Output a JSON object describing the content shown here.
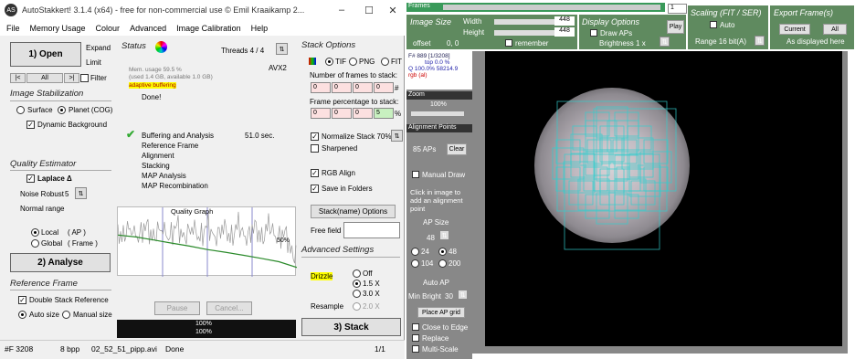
{
  "window": {
    "title": "AutoStakkert! 3.1.4 (x64) - free for non-commercial use © Emil Kraaikamp 2...",
    "min": "–",
    "max": "☐",
    "close": "✕"
  },
  "menu": [
    "File",
    "Memory Usage",
    "Colour",
    "Advanced",
    "Image Calibration",
    "Help"
  ],
  "left": {
    "open": "1) Open",
    "expand": "Expand",
    "limit": "Limit",
    "nav": {
      "first": "|<",
      "all": "All",
      ">|": ">|",
      "filter": "Filter"
    },
    "stab_title": "Image Stabilization",
    "surface": "Surface",
    "planet": "Planet (COG)",
    "dynbg": "Dynamic Background",
    "qe_title": "Quality Estimator",
    "laplace": "Laplace Δ",
    "noise": "Noise Robust",
    "noise_val": "5",
    "normal": "Normal range",
    "local": "Local",
    "local_sub": "( AP )",
    "global": "Global",
    "global_sub": "( Frame )",
    "analyse": "2) Analyse",
    "ref_title": "Reference Frame",
    "double": "Double Stack Reference",
    "autosize": "Auto size",
    "manualsize": "Manual size"
  },
  "status": {
    "title": "Status",
    "threads": "Threads 4 / 4",
    "avx": "AVX2",
    "mem1": "Mem. usage 59.5 %",
    "mem2": "(used 1.4 GB, available 1.0 GB)",
    "adaptive": "adaptive buffering",
    "done": "Done!",
    "steps": [
      "Buffering and Analysis",
      "Reference Frame",
      "Alignment",
      "Stacking",
      "MAP Analysis",
      "MAP Recombination"
    ],
    "time": "51.0 sec.",
    "graph_title": "Quality Graph",
    "graph_pct": "50%",
    "pause": "Pause",
    "cancel": "Cancel...",
    "prog1": "100%",
    "prog2": "100%"
  },
  "stack": {
    "title": "Stack Options",
    "tif": "TIF",
    "png": "PNG",
    "fit": "FIT",
    "nframes": "Number of frames to stack:",
    "nvals": [
      "0",
      "0",
      "0",
      "0"
    ],
    "hash": "#",
    "pct": "Frame percentage to stack:",
    "pvals": [
      "0",
      "0",
      "0",
      "5"
    ],
    "pctsign": "%",
    "normalize": "Normalize Stack 70%",
    "sharpened": "Sharpened",
    "rgb": "RGB Align",
    "folders": "Save in Folders",
    "stackname": "Stack(name) Options",
    "freefield": "Free field",
    "adv_title": "Advanced Settings",
    "drizzle": "Drizzle",
    "off": "Off",
    "x15": "1.5 X",
    "x30": "3.0 X",
    "resample": "Resample",
    "x20": "2.0 X",
    "stackbtn": "3) Stack"
  },
  "statusbar": {
    "frame": "#F 3208",
    "bpp": "8 bpp",
    "file": "02_52_51_pipp.avi",
    "state": "Done",
    "page": "1/1"
  },
  "right": {
    "frames_label": "Frames",
    "frame_val": "1",
    "imgsize": "Image Size",
    "width": "Width",
    "height": "Height",
    "wval": "448",
    "hval": "448",
    "offset": "offset",
    "offval": "0, 0",
    "remember": "remember",
    "display": "Display Options",
    "drawaps": "Draw APs",
    "brightness": "Brightness 1 x",
    "play": "Play",
    "scaling": "Scaling (FIT / SER)",
    "auto": "Auto",
    "range": "Range 16 bit(A)",
    "export": "Export Frame(s)",
    "current": "Current",
    "all": "All",
    "asdisp": "As displayed here",
    "finfo1": "F# 889 [1/3208]",
    "finfo2": "top 0.0 %",
    "finfo3": "Q 100.0%  58214.9",
    "finfo4": "rgb (al)",
    "zoom": "Zoom",
    "zoomval": "100%",
    "ap_title": "Alignment Points",
    "aps": "85 APs",
    "clear": "Clear",
    "manual": "Manual Draw",
    "hint": "Click in image to add an alignment point",
    "apsize": "AP Size",
    "apval": "48",
    "s24": "24",
    "s48": "48",
    "s104": "104",
    "s200": "200",
    "autoap": "Auto AP",
    "minbright": "Min Bright",
    "mbval": "30",
    "placegrid": "Place AP grid",
    "close": "Close to Edge",
    "replace": "Replace",
    "multi": "Multi-Scale"
  },
  "chart_data": {
    "type": "line",
    "title": "Quality Graph",
    "xlabel": "",
    "ylabel": "",
    "series": [
      {
        "values": [
          0.95,
          0.9,
          0.82,
          0.74,
          0.66,
          0.57,
          0.5,
          0.42,
          0.34,
          0.25,
          0.1
        ]
      }
    ],
    "annotations": [
      "50%"
    ]
  }
}
